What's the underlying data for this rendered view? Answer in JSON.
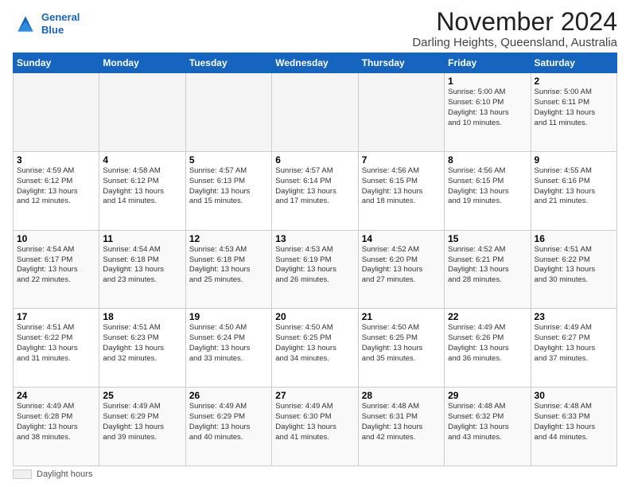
{
  "header": {
    "logo_line1": "General",
    "logo_line2": "Blue",
    "title": "November 2024",
    "subtitle": "Darling Heights, Queensland, Australia"
  },
  "days_of_week": [
    "Sunday",
    "Monday",
    "Tuesday",
    "Wednesday",
    "Thursday",
    "Friday",
    "Saturday"
  ],
  "weeks": [
    [
      {
        "day": "",
        "info": ""
      },
      {
        "day": "",
        "info": ""
      },
      {
        "day": "",
        "info": ""
      },
      {
        "day": "",
        "info": ""
      },
      {
        "day": "",
        "info": ""
      },
      {
        "day": "1",
        "info": "Sunrise: 5:00 AM\nSunset: 6:10 PM\nDaylight: 13 hours\nand 10 minutes."
      },
      {
        "day": "2",
        "info": "Sunrise: 5:00 AM\nSunset: 6:11 PM\nDaylight: 13 hours\nand 11 minutes."
      }
    ],
    [
      {
        "day": "3",
        "info": "Sunrise: 4:59 AM\nSunset: 6:12 PM\nDaylight: 13 hours\nand 12 minutes."
      },
      {
        "day": "4",
        "info": "Sunrise: 4:58 AM\nSunset: 6:12 PM\nDaylight: 13 hours\nand 14 minutes."
      },
      {
        "day": "5",
        "info": "Sunrise: 4:57 AM\nSunset: 6:13 PM\nDaylight: 13 hours\nand 15 minutes."
      },
      {
        "day": "6",
        "info": "Sunrise: 4:57 AM\nSunset: 6:14 PM\nDaylight: 13 hours\nand 17 minutes."
      },
      {
        "day": "7",
        "info": "Sunrise: 4:56 AM\nSunset: 6:15 PM\nDaylight: 13 hours\nand 18 minutes."
      },
      {
        "day": "8",
        "info": "Sunrise: 4:56 AM\nSunset: 6:15 PM\nDaylight: 13 hours\nand 19 minutes."
      },
      {
        "day": "9",
        "info": "Sunrise: 4:55 AM\nSunset: 6:16 PM\nDaylight: 13 hours\nand 21 minutes."
      }
    ],
    [
      {
        "day": "10",
        "info": "Sunrise: 4:54 AM\nSunset: 6:17 PM\nDaylight: 13 hours\nand 22 minutes."
      },
      {
        "day": "11",
        "info": "Sunrise: 4:54 AM\nSunset: 6:18 PM\nDaylight: 13 hours\nand 23 minutes."
      },
      {
        "day": "12",
        "info": "Sunrise: 4:53 AM\nSunset: 6:18 PM\nDaylight: 13 hours\nand 25 minutes."
      },
      {
        "day": "13",
        "info": "Sunrise: 4:53 AM\nSunset: 6:19 PM\nDaylight: 13 hours\nand 26 minutes."
      },
      {
        "day": "14",
        "info": "Sunrise: 4:52 AM\nSunset: 6:20 PM\nDaylight: 13 hours\nand 27 minutes."
      },
      {
        "day": "15",
        "info": "Sunrise: 4:52 AM\nSunset: 6:21 PM\nDaylight: 13 hours\nand 28 minutes."
      },
      {
        "day": "16",
        "info": "Sunrise: 4:51 AM\nSunset: 6:22 PM\nDaylight: 13 hours\nand 30 minutes."
      }
    ],
    [
      {
        "day": "17",
        "info": "Sunrise: 4:51 AM\nSunset: 6:22 PM\nDaylight: 13 hours\nand 31 minutes."
      },
      {
        "day": "18",
        "info": "Sunrise: 4:51 AM\nSunset: 6:23 PM\nDaylight: 13 hours\nand 32 minutes."
      },
      {
        "day": "19",
        "info": "Sunrise: 4:50 AM\nSunset: 6:24 PM\nDaylight: 13 hours\nand 33 minutes."
      },
      {
        "day": "20",
        "info": "Sunrise: 4:50 AM\nSunset: 6:25 PM\nDaylight: 13 hours\nand 34 minutes."
      },
      {
        "day": "21",
        "info": "Sunrise: 4:50 AM\nSunset: 6:25 PM\nDaylight: 13 hours\nand 35 minutes."
      },
      {
        "day": "22",
        "info": "Sunrise: 4:49 AM\nSunset: 6:26 PM\nDaylight: 13 hours\nand 36 minutes."
      },
      {
        "day": "23",
        "info": "Sunrise: 4:49 AM\nSunset: 6:27 PM\nDaylight: 13 hours\nand 37 minutes."
      }
    ],
    [
      {
        "day": "24",
        "info": "Sunrise: 4:49 AM\nSunset: 6:28 PM\nDaylight: 13 hours\nand 38 minutes."
      },
      {
        "day": "25",
        "info": "Sunrise: 4:49 AM\nSunset: 6:29 PM\nDaylight: 13 hours\nand 39 minutes."
      },
      {
        "day": "26",
        "info": "Sunrise: 4:49 AM\nSunset: 6:29 PM\nDaylight: 13 hours\nand 40 minutes."
      },
      {
        "day": "27",
        "info": "Sunrise: 4:49 AM\nSunset: 6:30 PM\nDaylight: 13 hours\nand 41 minutes."
      },
      {
        "day": "28",
        "info": "Sunrise: 4:48 AM\nSunset: 6:31 PM\nDaylight: 13 hours\nand 42 minutes."
      },
      {
        "day": "29",
        "info": "Sunrise: 4:48 AM\nSunset: 6:32 PM\nDaylight: 13 hours\nand 43 minutes."
      },
      {
        "day": "30",
        "info": "Sunrise: 4:48 AM\nSunset: 6:33 PM\nDaylight: 13 hours\nand 44 minutes."
      }
    ]
  ],
  "footer": {
    "label": "Daylight hours"
  }
}
